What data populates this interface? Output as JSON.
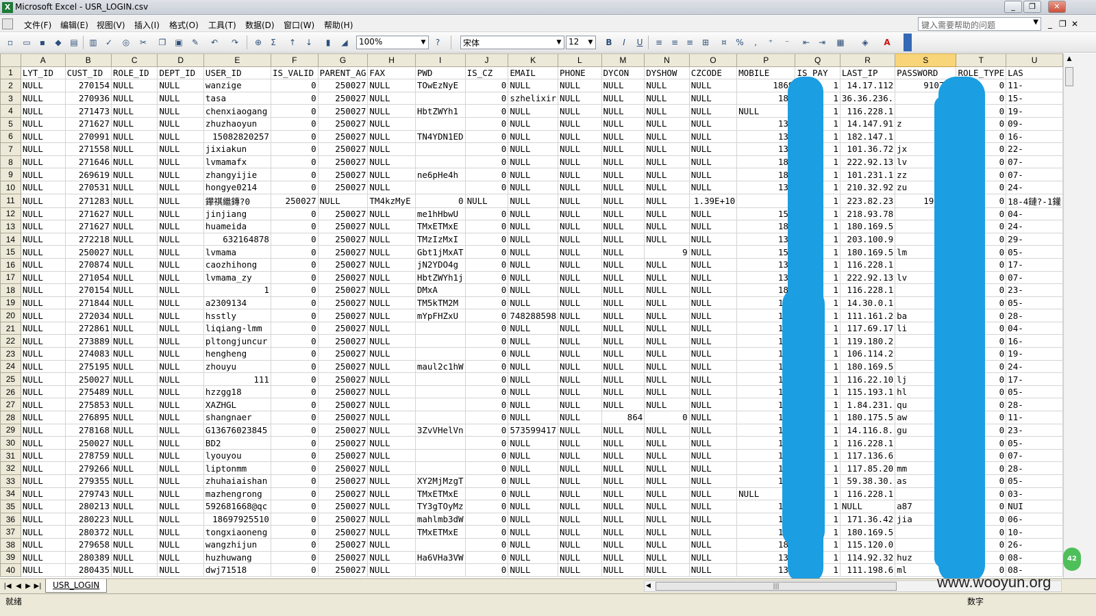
{
  "window": {
    "title": "Microsoft Excel - USR_LOGIN.csv",
    "minimize": "_",
    "restore": "❐",
    "close": "✕"
  },
  "menu": {
    "items": [
      "文件(F)",
      "编辑(E)",
      "视图(V)",
      "插入(I)",
      "格式(O)",
      "工具(T)",
      "数据(D)",
      "窗口(W)",
      "帮助(H)"
    ],
    "help_placeholder": "键入需要帮助的问题",
    "mdi_min": "_",
    "mdi_restore": "❐",
    "mdi_close": "✕"
  },
  "toolbar": {
    "zoom": "100%",
    "font_name": "宋体",
    "font_size": "12",
    "bold": "B",
    "italic": "I",
    "underline": "U",
    "percent": "%",
    "comma": ",",
    "sum": "Σ",
    "font_color_label": "A"
  },
  "sheet": {
    "columns": [
      "A",
      "B",
      "C",
      "D",
      "E",
      "F",
      "G",
      "H",
      "I",
      "J",
      "K",
      "L",
      "M",
      "N",
      "O",
      "P",
      "Q",
      "R",
      "S",
      "T",
      "U"
    ],
    "selected_column": "S",
    "rows": [
      [
        "1",
        "LYT_ID",
        "CUST_ID",
        "ROLE_ID",
        "DEPT_ID",
        "USER_ID",
        "IS_VALID",
        "PARENT_AG",
        "FAX",
        "PWD",
        "IS_CZ",
        "EMAIL",
        "PHONE",
        "DYCON",
        "DYSHOW",
        "CZCODE",
        "MOBILE",
        "IS_PAY",
        "LAST_IP",
        "PASSWORD",
        "ROLE_TYPE",
        "LAS"
      ],
      [
        "2",
        "NULL",
        "270154",
        "NULL",
        "NULL",
        "wanzige",
        "0",
        "250027",
        "NULL",
        "TOwEzNyE",
        "0",
        "NULL",
        "NULL",
        "NULL",
        "NULL",
        "NULL",
        "1869",
        "1",
        "14.17.112",
        "910712",
        "0",
        "11-"
      ],
      [
        "3",
        "NULL",
        "270936",
        "NULL",
        "NULL",
        "tasa",
        "0",
        "250027",
        "NULL",
        "",
        "0",
        "szhelixir",
        "NULL",
        "NULL",
        "NULL",
        "NULL",
        "189",
        "1",
        "36.36.236.",
        "",
        "0",
        "15-"
      ],
      [
        "4",
        "NULL",
        "271473",
        "NULL",
        "NULL",
        "chenxiaogang",
        "0",
        "250027",
        "NULL",
        "HbtZWYh1",
        "0",
        "NULL",
        "NULL",
        "NULL",
        "NULL",
        "NULL",
        "NULL",
        "1",
        "116.228.1",
        "",
        "0",
        "19-"
      ],
      [
        "5",
        "NULL",
        "271627",
        "NULL",
        "NULL",
        "zhuzhaoyun",
        "0",
        "250027",
        "NULL",
        "",
        "0",
        "NULL",
        "NULL",
        "NULL",
        "NULL",
        "NULL",
        "135",
        "1",
        "14.147.91",
        "z",
        "0",
        "09-"
      ],
      [
        "6",
        "NULL",
        "270991",
        "NULL",
        "NULL",
        "15082820257",
        "0",
        "250027",
        "NULL",
        "TN4YDN1ED",
        "0",
        "NULL",
        "NULL",
        "NULL",
        "NULL",
        "NULL",
        "139",
        "1",
        "182.147.1",
        "443",
        "0",
        "16-"
      ],
      [
        "7",
        "NULL",
        "271558",
        "NULL",
        "NULL",
        "jixiakun",
        "0",
        "250027",
        "NULL",
        "",
        "0",
        "NULL",
        "NULL",
        "NULL",
        "NULL",
        "NULL",
        "131",
        "1",
        "101.36.72",
        "jx",
        "0",
        "22-"
      ],
      [
        "8",
        "NULL",
        "271646",
        "NULL",
        "NULL",
        "lvmamafx",
        "0",
        "250027",
        "NULL",
        "",
        "0",
        "NULL",
        "NULL",
        "NULL",
        "NULL",
        "NULL",
        "185",
        "1",
        "222.92.13",
        "lv",
        "0",
        "07-"
      ],
      [
        "9",
        "NULL",
        "269619",
        "NULL",
        "NULL",
        "zhangyijie",
        "0",
        "250027",
        "NULL",
        "ne6pHe4h",
        "0",
        "NULL",
        "NULL",
        "NULL",
        "NULL",
        "NULL",
        "189",
        "1",
        "101.231.1",
        "zz",
        "0",
        "07-"
      ],
      [
        "10",
        "NULL",
        "270531",
        "NULL",
        "NULL",
        "hongye0214",
        "0",
        "250027",
        "NULL",
        "",
        "0",
        "NULL",
        "NULL",
        "NULL",
        "NULL",
        "NULL",
        "137",
        "1",
        "210.32.92",
        "zu",
        "0",
        "24-"
      ],
      [
        "11",
        "NULL",
        "271283",
        "NULL",
        "NULL",
        "鑻祺繼鏄?0",
        "250027",
        "NULL",
        "TM4kzMyE",
        "0",
        "NULL",
        "NULL",
        "NULL",
        "NULL",
        "NULL",
        "1.39E+10",
        "",
        "1",
        "223.82.23",
        "198312",
        "0",
        "18-4鏈?-1鑵"
      ],
      [
        "12",
        "NULL",
        "271627",
        "NULL",
        "NULL",
        "jinjiang",
        "0",
        "250027",
        "NULL",
        "me1hHbwU",
        "0",
        "NULL",
        "NULL",
        "NULL",
        "NULL",
        "NULL",
        "151",
        "1",
        "218.93.78",
        "11",
        "0",
        "04-"
      ],
      [
        "13",
        "NULL",
        "271627",
        "NULL",
        "NULL",
        "huameida",
        "0",
        "250027",
        "NULL",
        "TMxETMxE",
        "0",
        "NULL",
        "NULL",
        "NULL",
        "NULL",
        "NULL",
        "182",
        "1",
        "180.169.5",
        "11",
        "0",
        "24-"
      ],
      [
        "14",
        "NULL",
        "272218",
        "NULL",
        "NULL",
        "632164878",
        "0",
        "250027",
        "NULL",
        "TMzIzMxI",
        "0",
        "NULL",
        "NULL",
        "NULL",
        "NULL",
        "NULL",
        "131",
        "1",
        "203.100.9",
        "21",
        "0",
        "29-"
      ],
      [
        "15",
        "NULL",
        "250027",
        "NULL",
        "NULL",
        "lvmama",
        "0",
        "250027",
        "NULL",
        "Gbt1jMxAT",
        "0",
        "NULL",
        "NULL",
        "NULL",
        "9",
        "NULL",
        "158",
        "1",
        "180.169.5",
        "lm",
        "0",
        "05-"
      ],
      [
        "16",
        "NULL",
        "270874",
        "NULL",
        "NULL",
        "caozhihong",
        "0",
        "250027",
        "NULL",
        "jN2YDO4g",
        "0",
        "NULL",
        "NULL",
        "NULL",
        "NULL",
        "NULL",
        "138",
        "1",
        "116.228.1",
        "88",
        "0",
        "17-"
      ],
      [
        "17",
        "NULL",
        "271054",
        "NULL",
        "NULL",
        "lvmama_zy",
        "0",
        "250027",
        "NULL",
        "HbtZWYh1j",
        "0",
        "NULL",
        "NULL",
        "NULL",
        "NULL",
        "NULL",
        "133",
        "1",
        "222.92.13",
        "lv",
        "0",
        "07-"
      ],
      [
        "18",
        "NULL",
        "270154",
        "NULL",
        "NULL",
        "1",
        "0",
        "250027",
        "NULL",
        "DMxA",
        "0",
        "NULL",
        "NULL",
        "NULL",
        "NULL",
        "NULL",
        "186",
        "1",
        "116.228.1",
        "1",
        "0",
        "23-"
      ],
      [
        "19",
        "NULL",
        "271844",
        "NULL",
        "NULL",
        "a2309134",
        "0",
        "250027",
        "NULL",
        "TM5kTM2M",
        "0",
        "NULL",
        "NULL",
        "NULL",
        "NULL",
        "NULL",
        "181",
        "1",
        "14.30.0.1",
        "36",
        "0",
        "05-"
      ],
      [
        "20",
        "NULL",
        "272034",
        "NULL",
        "NULL",
        "hsstly",
        "0",
        "250027",
        "NULL",
        "mYpFHZxU",
        "0",
        "748288598",
        "NULL",
        "NULL",
        "NULL",
        "NULL",
        "152",
        "1",
        "111.161.2",
        "ba",
        "0",
        "28-"
      ],
      [
        "21",
        "NULL",
        "272861",
        "NULL",
        "NULL",
        "liqiang-lmm",
        "0",
        "250027",
        "NULL",
        "",
        "0",
        "NULL",
        "NULL",
        "NULL",
        "NULL",
        "NULL",
        "182",
        "1",
        "117.69.17",
        "li",
        "0",
        "04-"
      ],
      [
        "22",
        "NULL",
        "273889",
        "NULL",
        "NULL",
        "pltongjuncur",
        "0",
        "250027",
        "NULL",
        "",
        "0",
        "NULL",
        "NULL",
        "NULL",
        "NULL",
        "NULL",
        "151",
        "1",
        "119.180.2",
        "",
        "0",
        "16-"
      ],
      [
        "23",
        "NULL",
        "274083",
        "NULL",
        "NULL",
        "hengheng",
        "0",
        "250027",
        "NULL",
        "",
        "0",
        "NULL",
        "NULL",
        "NULL",
        "NULL",
        "NULL",
        "180",
        "1",
        "106.114.2",
        "56",
        "0",
        "19-"
      ],
      [
        "24",
        "NULL",
        "275195",
        "NULL",
        "NULL",
        "zhouyu",
        "0",
        "250027",
        "NULL",
        "maul2c1hW",
        "0",
        "NULL",
        "NULL",
        "NULL",
        "NULL",
        "NULL",
        "136",
        "1",
        "180.169.5",
        "26",
        "0",
        "24-"
      ],
      [
        "25",
        "NULL",
        "250027",
        "NULL",
        "NULL",
        "111",
        "0",
        "250027",
        "NULL",
        "",
        "0",
        "NULL",
        "NULL",
        "NULL",
        "NULL",
        "NULL",
        "111",
        "1",
        "116.22.10",
        "lj",
        "0",
        "17-"
      ],
      [
        "26",
        "NULL",
        "275489",
        "NULL",
        "NULL",
        "hzzgg18",
        "0",
        "250027",
        "NULL",
        "",
        "0",
        "NULL",
        "NULL",
        "NULL",
        "NULL",
        "NULL",
        "136",
        "1",
        "115.193.1",
        "hl",
        "0",
        "05-"
      ],
      [
        "27",
        "NULL",
        "275853",
        "NULL",
        "NULL",
        "XAZHGL",
        "0",
        "250027",
        "NULL",
        "",
        "0",
        "NULL",
        "NULL",
        "NULL",
        "NULL",
        "NULL",
        "180",
        "1",
        "1.84.231.",
        "qu",
        "0",
        "28-"
      ],
      [
        "28",
        "NULL",
        "276895",
        "NULL",
        "NULL",
        "shangnaer",
        "0",
        "250027",
        "NULL",
        "",
        "0",
        "NULL",
        "NULL",
        "864",
        "0",
        "NULL",
        "139",
        "1",
        "180.175.5",
        "aw",
        "0",
        "11-"
      ],
      [
        "29",
        "NULL",
        "278168",
        "NULL",
        "NULL",
        "G13676023845",
        "0",
        "250027",
        "NULL",
        "3ZvVHelVn",
        "0",
        "573599417",
        "NULL",
        "NULL",
        "NULL",
        "NULL",
        "136",
        "1",
        "14.116.8.",
        "gu",
        "0",
        "23-"
      ],
      [
        "30",
        "NULL",
        "250027",
        "NULL",
        "NULL",
        "BD2",
        "0",
        "250027",
        "NULL",
        "",
        "0",
        "NULL",
        "NULL",
        "NULL",
        "NULL",
        "NULL",
        "111",
        "1",
        "116.228.1",
        "99",
        "0",
        "05-"
      ],
      [
        "31",
        "NULL",
        "278759",
        "NULL",
        "NULL",
        "lyouyou",
        "0",
        "250027",
        "NULL",
        "",
        "0",
        "NULL",
        "NULL",
        "NULL",
        "NULL",
        "NULL",
        "189",
        "1",
        "117.136.6",
        "56",
        "0",
        "07-"
      ],
      [
        "32",
        "NULL",
        "279266",
        "NULL",
        "NULL",
        "liptonmm",
        "0",
        "250027",
        "NULL",
        "",
        "0",
        "NULL",
        "NULL",
        "NULL",
        "NULL",
        "NULL",
        "180",
        "1",
        "117.85.20",
        "mm",
        "0",
        "28-"
      ],
      [
        "33",
        "NULL",
        "279355",
        "NULL",
        "NULL",
        "zhuhaiaishan",
        "0",
        "250027",
        "NULL",
        "XY2MjMzgT",
        "0",
        "NULL",
        "NULL",
        "NULL",
        "NULL",
        "NULL",
        "159",
        "1",
        "59.38.30.",
        "as",
        "0",
        "05-"
      ],
      [
        "34",
        "NULL",
        "279743",
        "NULL",
        "NULL",
        "mazhengrong",
        "0",
        "250027",
        "NULL",
        "TMxETMxE",
        "0",
        "NULL",
        "NULL",
        "NULL",
        "NULL",
        "NULL",
        "NULL",
        "1",
        "116.228.1",
        "11",
        "0",
        "03-"
      ],
      [
        "35",
        "NULL",
        "280213",
        "NULL",
        "NULL",
        "592681668@qc",
        "0",
        "250027",
        "NULL",
        "TY3gTOyMz",
        "0",
        "NULL",
        "NULL",
        "NULL",
        "NULL",
        "NULL",
        "159",
        "1",
        "NULL",
        "a87",
        "0",
        "NUI"
      ],
      [
        "36",
        "NULL",
        "280223",
        "NULL",
        "NULL",
        "18697925510",
        "0",
        "250027",
        "NULL",
        "mahlmb3dW",
        "0",
        "NULL",
        "NULL",
        "NULL",
        "NULL",
        "NULL",
        "186",
        "1",
        "171.36.42",
        "jia",
        "0",
        "06-"
      ],
      [
        "37",
        "NULL",
        "280372",
        "NULL",
        "NULL",
        "tongxiaoneng",
        "0",
        "250027",
        "NULL",
        "TMxETMxE",
        "0",
        "NULL",
        "NULL",
        "NULL",
        "NULL",
        "NULL",
        "135",
        "1",
        "180.169.5",
        "11",
        "0",
        "10-"
      ],
      [
        "38",
        "NULL",
        "279658",
        "NULL",
        "NULL",
        "wangzhijun",
        "0",
        "250027",
        "NULL",
        "",
        "0",
        "NULL",
        "NULL",
        "NULL",
        "NULL",
        "NULL",
        "182",
        "1",
        "115.120.0",
        "456",
        "0",
        "26-"
      ],
      [
        "39",
        "NULL",
        "280389",
        "NULL",
        "NULL",
        "huzhuwang",
        "0",
        "250027",
        "NULL",
        "Ha6VHa3VW",
        "0",
        "NULL",
        "NULL",
        "NULL",
        "NULL",
        "NULL",
        "138",
        "1",
        "114.92.32",
        "huz",
        "0",
        "08-"
      ],
      [
        "40",
        "NULL",
        "280435",
        "NULL",
        "NULL",
        "dwj71518",
        "0",
        "250027",
        "NULL",
        "",
        "0",
        "NULL",
        "NULL",
        "NULL",
        "NULL",
        "NULL",
        "137",
        "1",
        "111.198.6",
        "ml",
        "0",
        "08-"
      ]
    ]
  },
  "tabs": {
    "sheet_name": "USR_LOGIN"
  },
  "status": {
    "ready": "就绪",
    "mode": "数字"
  },
  "badge": "42",
  "watermark": "www.wooyun.org",
  "colors": {
    "redaction": "#1b9ee2",
    "selected_header": "#f9d57a",
    "header_bg": "#ece9d8"
  }
}
